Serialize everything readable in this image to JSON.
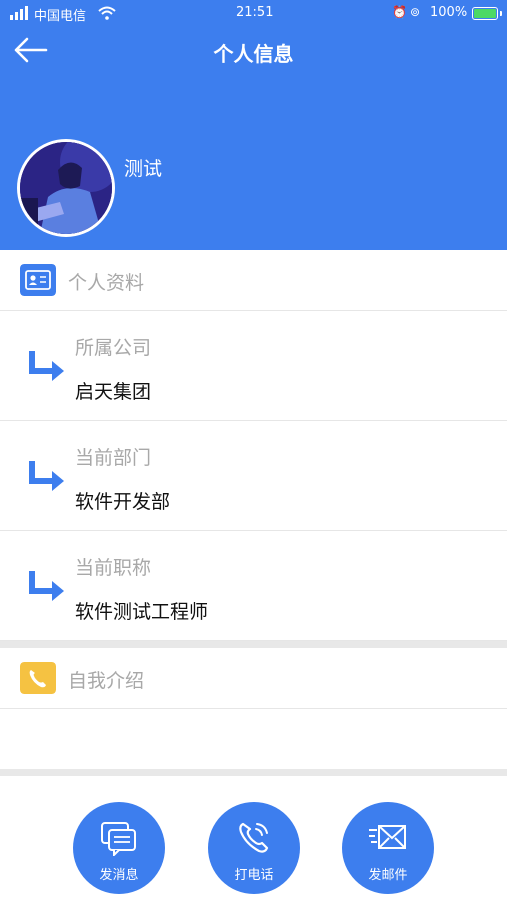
{
  "status_bar": {
    "carrier": "中国电信",
    "time": "21:51",
    "battery": "100%"
  },
  "header": {
    "title": "个人信息",
    "username": "测试"
  },
  "profile_section": {
    "label": "个人资料",
    "rows": [
      {
        "label": "所属公司",
        "value": "启天集团"
      },
      {
        "label": "当前部门",
        "value": "软件开发部"
      },
      {
        "label": "当前职称",
        "value": "软件测试工程师"
      }
    ]
  },
  "intro_section": {
    "label": "自我介绍"
  },
  "actions": [
    {
      "label": "发消息",
      "icon": "chat-icon"
    },
    {
      "label": "打电话",
      "icon": "phone-icon"
    },
    {
      "label": "发邮件",
      "icon": "mail-icon"
    }
  ],
  "colors": {
    "primary": "#3d7eee",
    "accent_yellow": "#f5c242",
    "battery_green": "#4cd964"
  }
}
